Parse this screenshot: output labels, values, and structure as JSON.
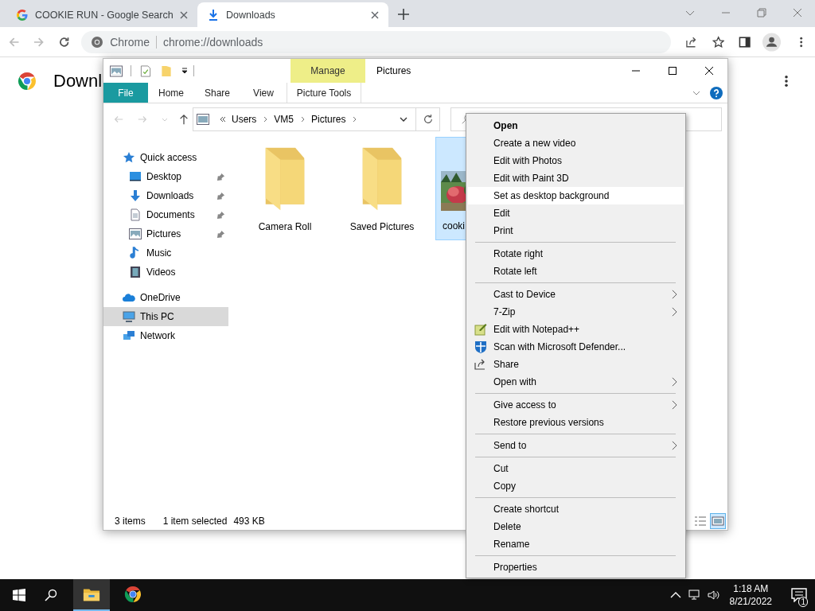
{
  "browser": {
    "tabs": [
      {
        "title": "COOKIE RUN - Google Search",
        "kind": "google",
        "selected": false
      },
      {
        "title": "Downloads",
        "kind": "download",
        "selected": true
      }
    ],
    "omnibox": {
      "site_label": "Chrome",
      "url": "chrome://downloads"
    },
    "page": {
      "heading": "Downl"
    }
  },
  "explorer": {
    "window_title": "Pictures",
    "contextual_header": "Manage",
    "ribbon_tabs": [
      {
        "label": "File",
        "kind": "file"
      },
      {
        "label": "Home",
        "kind": "tab"
      },
      {
        "label": "Share",
        "kind": "tab"
      },
      {
        "label": "View",
        "kind": "tab"
      },
      {
        "label": "Picture Tools",
        "kind": "contextual"
      }
    ],
    "breadcrumb": [
      "Users",
      "VM5",
      "Pictures"
    ],
    "nav": [
      {
        "label": "Quick access",
        "kind": "star",
        "selected": false,
        "children": [
          {
            "label": "Desktop",
            "kind": "desktop",
            "pinned": true,
            "selected": false
          },
          {
            "label": "Downloads",
            "kind": "downloads",
            "pinned": true,
            "selected": false
          },
          {
            "label": "Documents",
            "kind": "documents",
            "pinned": true,
            "selected": false
          },
          {
            "label": "Pictures",
            "kind": "pictures",
            "pinned": true,
            "selected": false
          },
          {
            "label": "Music",
            "kind": "music",
            "pinned": false,
            "selected": false
          },
          {
            "label": "Videos",
            "kind": "videos",
            "pinned": false,
            "selected": false
          }
        ]
      },
      {
        "label": "OneDrive",
        "kind": "cloud",
        "selected": false
      },
      {
        "label": "This PC",
        "kind": "pc",
        "selected": true
      },
      {
        "label": "Network",
        "kind": "network",
        "selected": false
      }
    ],
    "items": [
      {
        "name": "Camera Roll",
        "kind": "folder",
        "selected": false
      },
      {
        "name": "Saved Pictures",
        "kind": "folder",
        "selected": false
      },
      {
        "name": "cooki",
        "kind": "picture",
        "selected": true
      }
    ],
    "status": {
      "count": "3 items",
      "selection": "1 item selected",
      "size": "493 KB"
    },
    "view_modes": [
      {
        "kind": "details",
        "selected": false
      },
      {
        "kind": "large_icons",
        "selected": true
      }
    ]
  },
  "context_menu": {
    "groups": [
      [
        {
          "label": "Open",
          "default": true,
          "highlighted": false,
          "submenu": false
        },
        {
          "label": "Create a new video",
          "default": false,
          "highlighted": false,
          "submenu": false
        },
        {
          "label": "Edit with Photos",
          "default": false,
          "highlighted": false,
          "submenu": false
        },
        {
          "label": "Edit with Paint 3D",
          "default": false,
          "highlighted": false,
          "submenu": false
        },
        {
          "label": "Set as desktop background",
          "default": false,
          "highlighted": true,
          "submenu": false
        },
        {
          "label": "Edit",
          "default": false,
          "highlighted": false,
          "submenu": false
        },
        {
          "label": "Print",
          "default": false,
          "highlighted": false,
          "submenu": false
        }
      ],
      [
        {
          "label": "Rotate right",
          "default": false,
          "highlighted": false,
          "submenu": false
        },
        {
          "label": "Rotate left",
          "default": false,
          "highlighted": false,
          "submenu": false
        }
      ],
      [
        {
          "label": "Cast to Device",
          "default": false,
          "highlighted": false,
          "submenu": true
        },
        {
          "label": "7-Zip",
          "default": false,
          "highlighted": false,
          "submenu": true
        },
        {
          "label": "Edit with Notepad++",
          "kind": "notepad",
          "default": false,
          "highlighted": false,
          "submenu": false
        },
        {
          "label": "Scan with Microsoft Defender...",
          "kind": "defender",
          "default": false,
          "highlighted": false,
          "submenu": false
        },
        {
          "label": "Share",
          "kind": "share",
          "default": false,
          "highlighted": false,
          "submenu": false
        },
        {
          "label": "Open with",
          "default": false,
          "highlighted": false,
          "submenu": true
        }
      ],
      [
        {
          "label": "Give access to",
          "default": false,
          "highlighted": false,
          "submenu": true
        },
        {
          "label": "Restore previous versions",
          "default": false,
          "highlighted": false,
          "submenu": false
        }
      ],
      [
        {
          "label": "Send to",
          "default": false,
          "highlighted": false,
          "submenu": true
        }
      ],
      [
        {
          "label": "Cut",
          "default": false,
          "highlighted": false,
          "submenu": false
        },
        {
          "label": "Copy",
          "default": false,
          "highlighted": false,
          "submenu": false
        }
      ],
      [
        {
          "label": "Create shortcut",
          "default": false,
          "highlighted": false,
          "submenu": false
        },
        {
          "label": "Delete",
          "default": false,
          "highlighted": false,
          "submenu": false
        },
        {
          "label": "Rename",
          "default": false,
          "highlighted": false,
          "submenu": false
        }
      ],
      [
        {
          "label": "Properties",
          "default": false,
          "highlighted": false,
          "submenu": false
        }
      ]
    ]
  },
  "taskbar": {
    "apps": [
      {
        "kind": "explorer",
        "selected": true
      },
      {
        "kind": "chrome",
        "selected": false
      }
    ],
    "time": "1:18 AM",
    "date": "8/21/2022",
    "notifications": "1"
  }
}
